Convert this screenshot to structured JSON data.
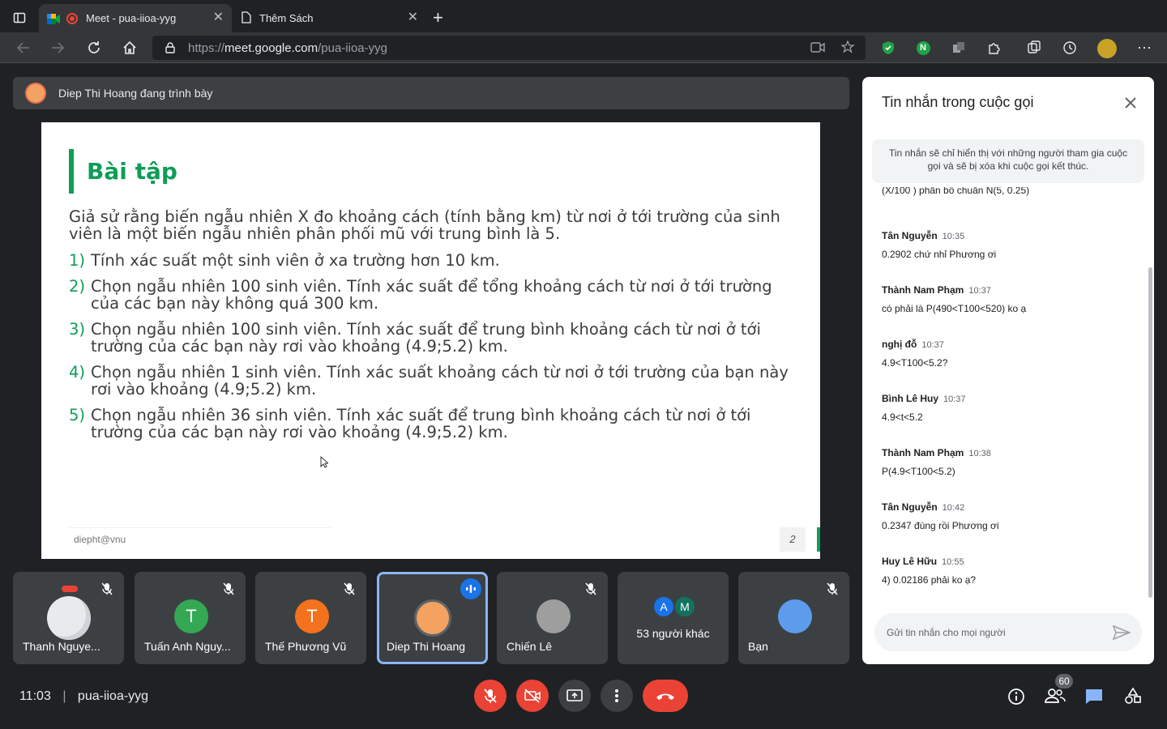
{
  "browser": {
    "tabs": [
      {
        "label": "Meet - pua-iioa-yyg",
        "active": true
      },
      {
        "label": "Thêm Sách",
        "active": false
      }
    ],
    "url_prefix": "https://",
    "url_host": "meet.google.com",
    "url_path": "/pua-iioa-yyg"
  },
  "presenter_bar": {
    "text": "Diep Thi Hoang đang trình bày"
  },
  "slide": {
    "title": "Bài tập",
    "intro": "Giả sử rằng biến ngẫu nhiên X đo khoảng cách (tính bằng km) từ nơi ở tới trường của sinh viên là một biến ngẫu nhiên phân phối mũ với trung bình là 5.",
    "items": [
      {
        "num": "1)",
        "text": "Tính xác suất một sinh viên ở xa trường hơn 10 km."
      },
      {
        "num": "2)",
        "text": "Chọn ngẫu nhiên 100 sinh viên. Tính xác suất để tổng khoảng cách từ nơi ở tới trường của các bạn này không quá 300 km."
      },
      {
        "num": "3)",
        "text": "Chọn ngẫu nhiên 100 sinh viên. Tính xác suất để trung bình khoảng cách từ nơi ở tới trường của các bạn này rơi vào khoảng (4.9;5.2) km."
      },
      {
        "num": "4)",
        "text": "Chọn ngẫu nhiên 1 sinh viên. Tính xác suất khoảng cách từ nơi ở tới trường của bạn này rơi vào khoảng (4.9;5.2) km."
      },
      {
        "num": "5)",
        "text": "Chọn ngẫu nhiên 36 sinh viên. Tính xác suất để trung bình khoảng cách từ nơi ở tới trường của các bạn này rơi vào khoảng (4.9;5.2) km."
      }
    ],
    "footer_left": "diepht@vnu",
    "page_number": "2"
  },
  "participants": [
    {
      "name": "Thanh Nguye...",
      "initial": "",
      "color": "#6a4c93",
      "muted": true
    },
    {
      "name": "Tuấn Anh Nguy...",
      "initial": "T",
      "color": "#34a853",
      "muted": true
    },
    {
      "name": "Thế Phương Vũ",
      "initial": "T",
      "color": "#f4711e",
      "muted": true
    },
    {
      "name": "Diep Thi Hoang",
      "initial": "",
      "color": "#8d6e63",
      "muted": false,
      "speaking": true
    },
    {
      "name": "Chiến Lê",
      "initial": "",
      "color": "#9e9e9e",
      "muted": true
    },
    {
      "name": "53 người khác",
      "initial": "",
      "color": "",
      "muted": false
    },
    {
      "name": "Bạn",
      "initial": "",
      "color": "#5d9cec",
      "muted": true
    }
  ],
  "others_avatars": [
    "A",
    "M"
  ],
  "chat": {
    "title": "Tin nhắn trong cuộc gọi",
    "notice": "Tin nhắn sẽ chỉ hiển thị với những người tham gia cuộc gọi và sẽ bị xóa khi cuộc gọi kết thúc.",
    "partial": "(X/100 ) phân bố  chuẩn N(5, 0.25)",
    "messages": [
      {
        "sender": "Tân Nguyễn",
        "time": "10:35",
        "text": "0.2902 chứ nhỉ Phương ơi"
      },
      {
        "sender": "Thành Nam Phạm",
        "time": "10:37",
        "text": "có phải là P(490<T100<520) ko ạ"
      },
      {
        "sender": "nghị đỗ",
        "time": "10:37",
        "text": "4.9<T100<5.2?"
      },
      {
        "sender": "Bình Lê Huy",
        "time": "10:37",
        "text": "4.9<t<5.2"
      },
      {
        "sender": "Thành Nam Phạm",
        "time": "10:38",
        "text": "P(4.9<T100<5.2)"
      },
      {
        "sender": "Tân Nguyễn",
        "time": "10:42",
        "text": "0.2347 đúng rồi Phương ơi"
      },
      {
        "sender": "Huy Lê Hữu",
        "time": "10:55",
        "text": "4) 0.02186 phải ko ạ?"
      }
    ],
    "input_placeholder": "Gửi tin nhắn cho mọi người"
  },
  "bottom_bar": {
    "time": "11:03",
    "meeting_code": "pua-iioa-yyg",
    "participant_count": "60"
  },
  "colors": {
    "accent_green": "#0f9d58",
    "red": "#ea4335",
    "blue": "#8ab4f8"
  }
}
